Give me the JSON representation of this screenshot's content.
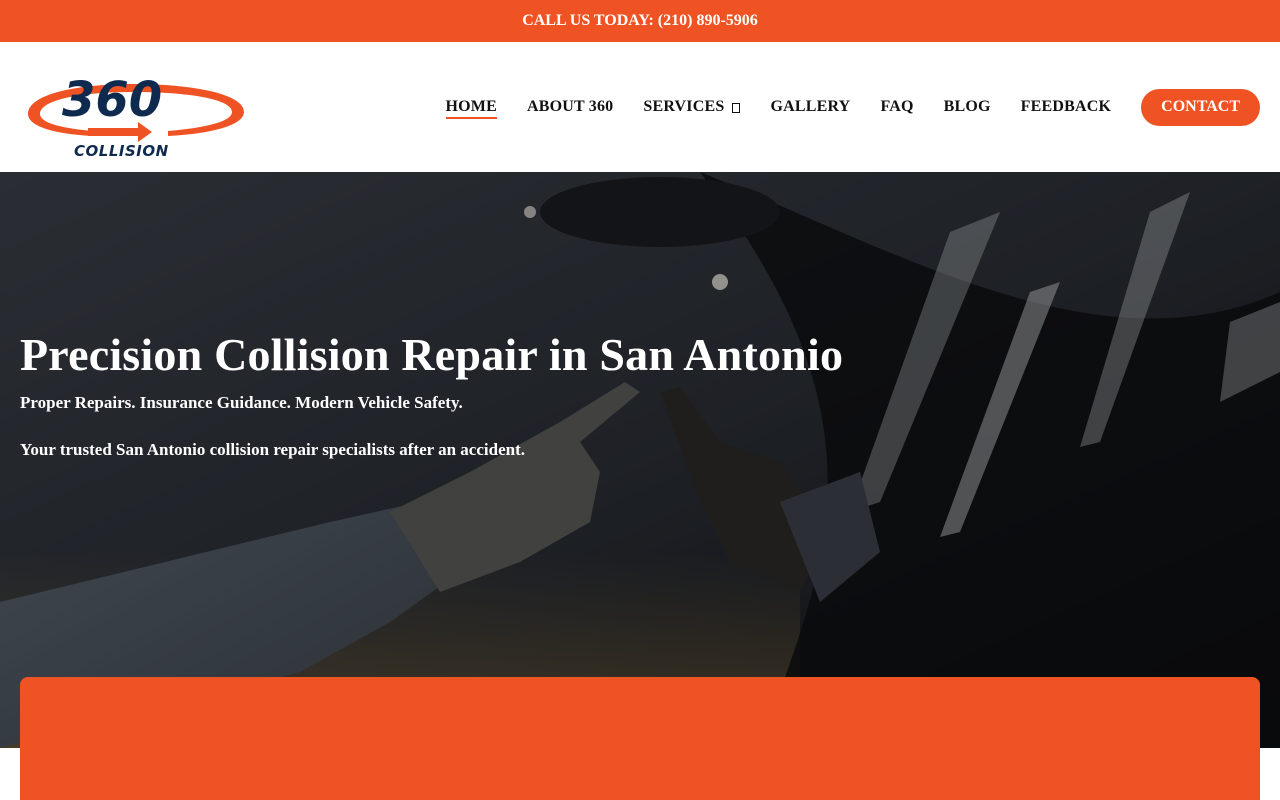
{
  "topbar": {
    "call_text": "CALL US TODAY: (210) 890-5906"
  },
  "logo": {
    "number": "360",
    "word": "COLLISION"
  },
  "nav": {
    "items": [
      {
        "label": "HOME"
      },
      {
        "label": "ABOUT 360"
      },
      {
        "label": "SERVICES"
      },
      {
        "label": "GALLERY"
      },
      {
        "label": "FAQ"
      },
      {
        "label": "BLOG"
      },
      {
        "label": "FEEDBACK"
      }
    ],
    "active": "HOME",
    "contact_label": "CONTACT"
  },
  "hero": {
    "title": "Precision Collision Repair in San Antonio",
    "subtitle": "Proper Repairs. Insurance Guidance. Modern Vehicle Safety.",
    "tagline": "Your trusted San Antonio collision repair specialists after an accident."
  },
  "colors": {
    "accent": "#f05323",
    "logo_navy": "#0e2a4f",
    "text_dark": "#111111"
  },
  "icons": {
    "services_dropdown": "chevron-down-icon"
  }
}
